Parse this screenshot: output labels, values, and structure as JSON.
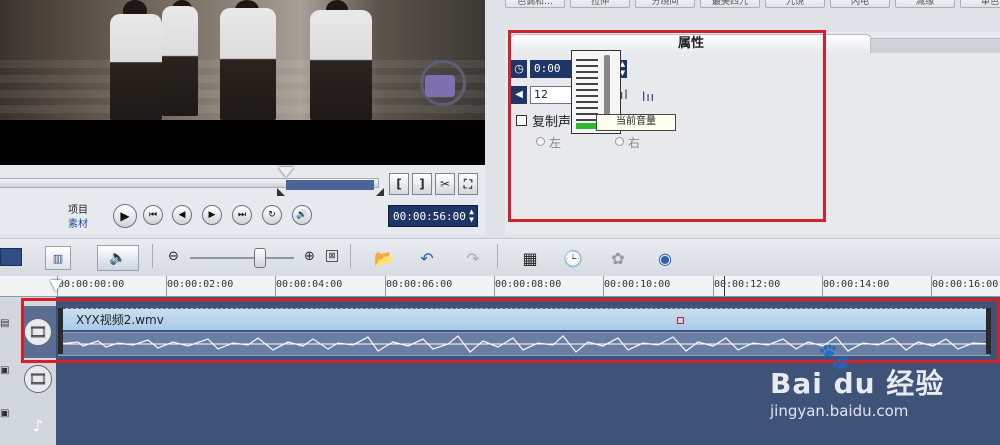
{
  "top_buttons": [
    "色调和…",
    "拉伸",
    "分绕间",
    "最美四九",
    "九饶",
    "闪电",
    "减缘",
    "单色"
  ],
  "player": {
    "mode_labels": {
      "project": "项目",
      "clip": "素材"
    },
    "timecode": "00:00:56:00",
    "trim_buttons": {
      "mark_in": "[",
      "mark_out": "]"
    }
  },
  "properties": {
    "tab_title": "属性",
    "duration_value": "0:00",
    "volume_value": "12",
    "meter_tooltip": "当前音量",
    "duplicate_label": "复制声",
    "left_label": "左",
    "right_label": "右"
  },
  "timeline": {
    "ruler_ticks": [
      "00:00:00:00",
      "00:00:02:00",
      "00:00:04:00",
      "00:00:06:00",
      "00:00:08:00",
      "00:00:10:00",
      "00:00:12:00",
      "00:00:14:00",
      "00:00:16:00"
    ],
    "clip_name": "XYX视频2.wmv"
  },
  "watermark": {
    "brand": "Bai du 经验",
    "url": "jingyan.baidu.com"
  }
}
